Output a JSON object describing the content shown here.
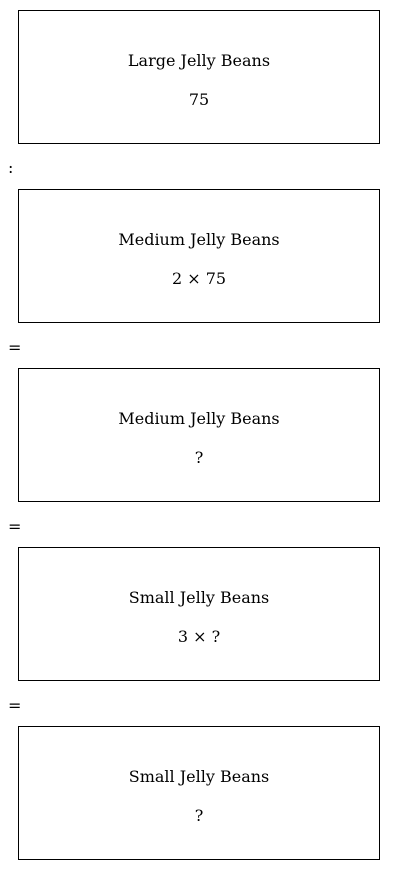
{
  "boxes": [
    {
      "title": "Large Jelly Beans",
      "value": "75"
    },
    {
      "title": "Medium Jelly Beans",
      "value": "2 × 75"
    },
    {
      "title": "Medium Jelly Beans",
      "value": "?"
    },
    {
      "title": "Small Jelly Beans",
      "value": "3 × ?"
    },
    {
      "title": "Small Jelly Beans",
      "value": "?"
    }
  ],
  "separators": [
    ":",
    "=",
    "=",
    "="
  ]
}
